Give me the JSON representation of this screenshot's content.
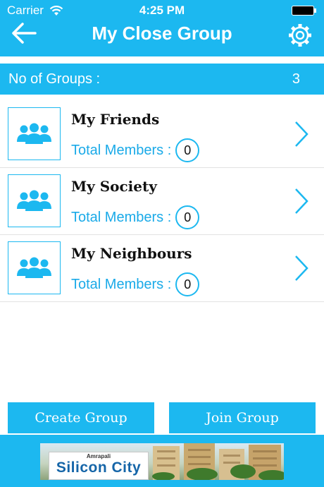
{
  "status_bar": {
    "carrier": "Carrier",
    "time": "4:25 PM"
  },
  "navbar": {
    "title": "My Close Group",
    "back_icon": "back-arrow-icon",
    "settings_icon": "gear-icon"
  },
  "summary": {
    "label": "No of Groups :",
    "count": "3"
  },
  "groups": [
    {
      "name": "My Friends",
      "members_label": "Total Members :",
      "members_count": "0"
    },
    {
      "name": "My Society",
      "members_label": "Total Members :",
      "members_count": "0"
    },
    {
      "name": "My Neighbours",
      "members_label": "Total Members :",
      "members_count": "0"
    }
  ],
  "actions": {
    "create_label": "Create Group",
    "join_label": "Join Group"
  },
  "ad": {
    "brand": "Amrapali",
    "name": "Silicon City"
  },
  "colors": {
    "accent": "#1cb8f0",
    "members_text": "#1aaae8"
  }
}
